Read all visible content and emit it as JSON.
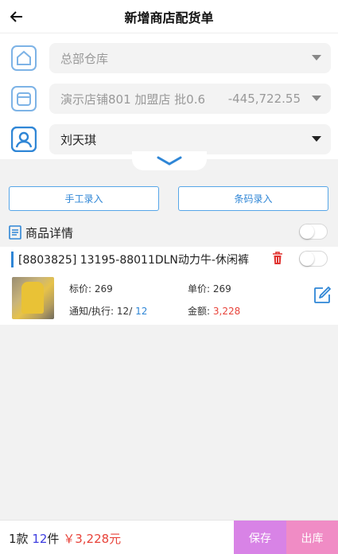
{
  "header": {
    "title": "新增商店配货单"
  },
  "form": {
    "warehouse": {
      "value": "总部仓库"
    },
    "store": {
      "value": "演示店铺801 加盟店 批0.6",
      "balance": "-445,722.55"
    },
    "staff": {
      "value": "刘天琪"
    }
  },
  "actions": {
    "manual_label": "手工录入",
    "barcode_label": "条码录入"
  },
  "section": {
    "title": "商品详情"
  },
  "product": {
    "name": "[8803825] 13195-88011DLN动力牛-休闲裤",
    "tag_price_label": "标价:",
    "tag_price": "269",
    "unit_price_label": "单价:",
    "unit_price": "269",
    "notice_label": "通知/执行:",
    "notice_done": "12/",
    "notice_qty": "12",
    "amount_label": "金额:",
    "amount": "3,228"
  },
  "footer": {
    "kinds": "1款",
    "pieces_num": "12",
    "pieces_unit": "件",
    "total": "￥3,228元",
    "save_label": "保存",
    "out_label": "出库"
  },
  "colors": {
    "accent": "#2f86d6",
    "save": "#d883e6",
    "out": "#f08cc5",
    "amount": "#e8433a"
  }
}
